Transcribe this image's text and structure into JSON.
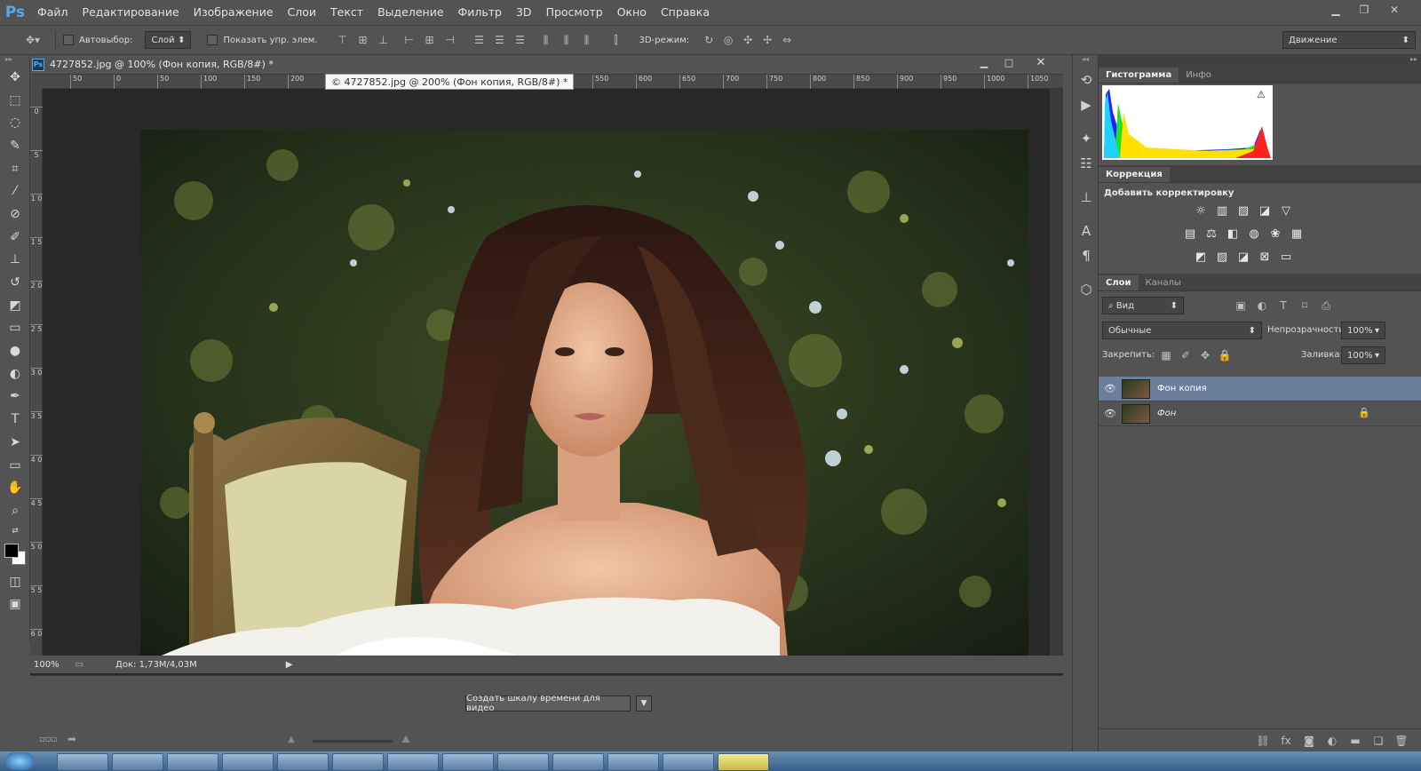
{
  "app": {
    "logo": "Ps"
  },
  "menu": [
    "Файл",
    "Редактирование",
    "Изображение",
    "Слои",
    "Текст",
    "Выделение",
    "Фильтр",
    "3D",
    "Просмотр",
    "Окно",
    "Справка"
  ],
  "options": {
    "autoselect_label": "Автовыбор:",
    "autoselect_value": "Слой",
    "show_controls_label": "Показать упр. элем.",
    "mode3d_label": "3D-режим:",
    "workspace": "Движение"
  },
  "document": {
    "tab_title": "4727852.jpg @ 100% (Фон копия, RGB/8#) *",
    "tooltip": "© 4727852.jpg @ 200% (Фон копия, RGB/8#) *",
    "ruler_h": [
      "50",
      "0",
      "50",
      "100",
      "150",
      "200",
      "250",
      "300",
      "350",
      "400",
      "450",
      "500",
      "550",
      "600",
      "650",
      "700",
      "750",
      "800",
      "850",
      "900",
      "950",
      "1000",
      "1050"
    ],
    "ruler_v": [
      "0",
      "5",
      "1 0",
      "1 5",
      "2 0",
      "2 5",
      "3 0",
      "3 5",
      "4 0",
      "4 5",
      "5 0",
      "5 5",
      "6 0"
    ]
  },
  "status": {
    "zoom": "100%",
    "doc": "Док: 1,73M/4,03M"
  },
  "timeline": {
    "create_button": "Создать шкалу времени для видео"
  },
  "panels": {
    "histogram_tab": "Гистограмма",
    "info_tab": "Инфо",
    "correction_tab": "Коррекция",
    "add_adjustment": "Добавить корректировку",
    "layers_tab": "Слои",
    "channels_tab": "Каналы",
    "filter_kind": "Вид",
    "blend_mode": "Обычные",
    "opacity_label": "Непрозрачность:",
    "opacity_value": "100%",
    "lock_label": "Закрепить:",
    "fill_label": "Заливка:",
    "fill_value": "100%"
  },
  "layers": [
    {
      "name": "Фон копия",
      "selected": true,
      "locked": false
    },
    {
      "name": "Фон",
      "selected": false,
      "locked": true
    }
  ],
  "colors": {
    "accent": "#5aa9e6",
    "selected_layer": "#6b7f9a",
    "panel": "#535353",
    "canvas_bg": "#282828"
  }
}
